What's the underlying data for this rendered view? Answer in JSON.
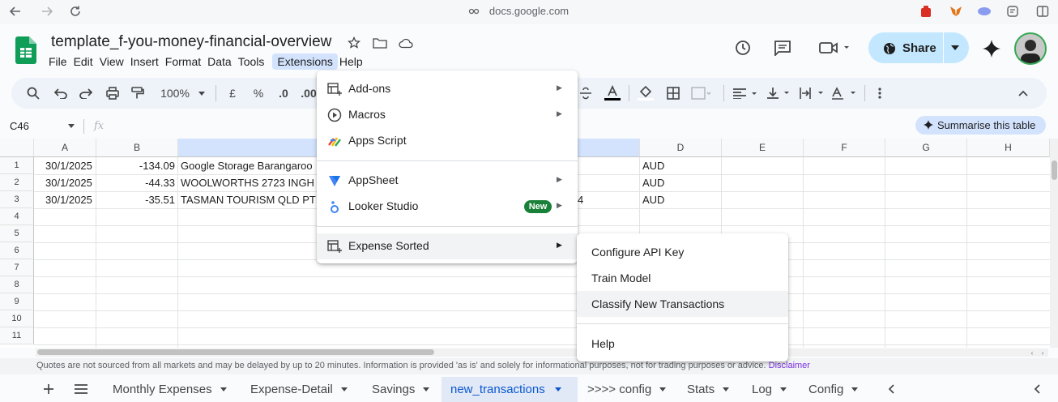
{
  "browser": {
    "url": "docs.google.com"
  },
  "doc": {
    "title": "template_f-you-money-financial-overview"
  },
  "menubar": [
    "File",
    "Edit",
    "View",
    "Insert",
    "Format",
    "Data",
    "Tools",
    "Extensions",
    "Help"
  ],
  "share": {
    "label": "Share"
  },
  "toolbar": {
    "zoom": "100%",
    "currency": "£",
    "percent": "%",
    "dec_decrease": ".0",
    "dec_increase": ".00"
  },
  "formula_bar": {
    "cell_ref": "C46",
    "fx": "fx",
    "summarise": "Summarise this table"
  },
  "grid": {
    "columns": [
      "A",
      "B",
      "C",
      "D",
      "E",
      "F",
      "G",
      "H"
    ],
    "rows": [
      "1",
      "2",
      "3",
      "4",
      "5",
      "6",
      "7",
      "8",
      "9",
      "10",
      "11"
    ],
    "data": [
      {
        "a": "30/1/2025",
        "b": "-134.09",
        "c": "Google Storage Barangaroo",
        "c2": "",
        "d": "AUD"
      },
      {
        "a": "30/1/2025",
        "b": "-44.33",
        "c": "WOOLWORTHS 2723 INGH",
        "c2": "",
        "d": "AUD"
      },
      {
        "a": "30/1/2025",
        "b": "-35.51",
        "c": "TASMAN TOURISM QLD PT",
        "c2": "4",
        "d": "AUD"
      }
    ]
  },
  "disclaimer": {
    "text": "Quotes are not sourced from all markets and may be delayed by up to 20 minutes. Information is provided 'as is' and solely for informational purposes, not for trading purposes or advice.",
    "link": "Disclaimer"
  },
  "sheet_tabs": [
    "Monthly Expenses",
    "Expense-Detail",
    "Savings",
    "new_transactions",
    ">>>> config",
    "Stats",
    "Log",
    "Config"
  ],
  "extensions_menu": {
    "items": [
      "Add-ons",
      "Macros",
      "Apps Script",
      "AppSheet",
      "Looker Studio",
      "Expense Sorted"
    ],
    "new_badge": "New"
  },
  "expense_sorted_menu": {
    "items": [
      "Configure API Key",
      "Train Model",
      "Classify New Transactions",
      "Help"
    ]
  },
  "colors": {
    "accent": "#0b57d0",
    "share_bg": "#c2e7ff",
    "selected_col": "#d3e3fd",
    "new_badge": "#188038"
  }
}
